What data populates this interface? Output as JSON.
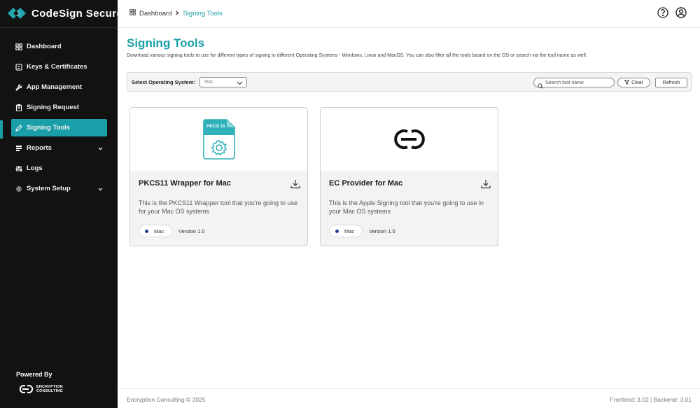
{
  "brand": {
    "name": "CodeSign Secure"
  },
  "sidebar": {
    "items": [
      {
        "label": "Dashboard",
        "icon": "dashboard-icon"
      },
      {
        "label": "Keys & Certificates",
        "icon": "key-icon"
      },
      {
        "label": "App Management",
        "icon": "wrench-icon"
      },
      {
        "label": "Signing Request",
        "icon": "clipboard-icon"
      },
      {
        "label": "Signing Tools",
        "icon": "pen-icon",
        "active": true
      },
      {
        "label": "Reports",
        "icon": "report-icon",
        "expandable": true
      },
      {
        "label": "Logs",
        "icon": "logs-icon"
      },
      {
        "label": "System Setup",
        "icon": "gear-icon",
        "expandable": true
      }
    ],
    "powered_by": "Powered By",
    "partner_logo_text": "ENCRYPTION CONSULTING"
  },
  "header": {
    "breadcrumb": {
      "home": "Dashboard",
      "current": "Signing Tools"
    },
    "icons": [
      "help-icon",
      "user-icon"
    ]
  },
  "main": {
    "title": "Signing Tools",
    "description": "Download various signing tools to use for different types of signing in different Operating Systems - Windows, Linux and MacOS. You can also filter all the tools based on the OS or search via the tool name as well.",
    "filter": {
      "os_label": "Select Operating System:",
      "os_selected": "Mac",
      "search_placeholder": "Search tool name",
      "clear_label": "Clear",
      "refresh_label": "Refresh"
    },
    "tools": [
      {
        "badge": "PKCS 11",
        "title": "PKCS11 Wrapper for Mac",
        "description": "This is the PKCS11 Wrapper tool that you're going to use for your Mac OS systems",
        "os": "Mac",
        "version": "Version 1.0"
      },
      {
        "title": "EC Provider for Mac",
        "description": "This is the Apple Signing tool that you're going to use in your Mac OS systems",
        "os": "Mac",
        "version": "Version 1.0"
      }
    ]
  },
  "footer": {
    "copyright": "Encryption Consulting © 2025",
    "versions": "Frontend: 3.02  |  Backend: 3.01"
  },
  "colors": {
    "accent": "#1a9ea8",
    "sidebar_bg": "#121212",
    "os_dot": "#1f3f8c"
  }
}
